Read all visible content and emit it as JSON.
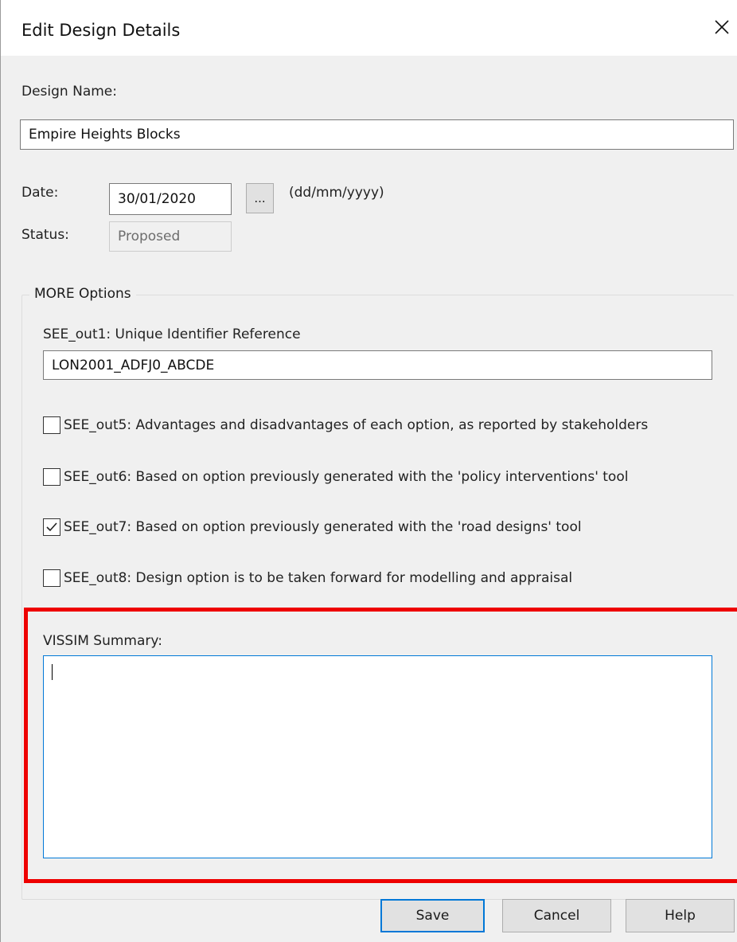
{
  "window": {
    "title": "Edit Design Details",
    "close_label": "✕"
  },
  "design_name": {
    "label": "Design Name:",
    "value": "Empire Heights  Blocks"
  },
  "date": {
    "label": "Date:",
    "value": "30/01/2020",
    "picker_label": "...",
    "format_hint": "(dd/mm/yyyy)"
  },
  "status": {
    "label": "Status:",
    "value": "Proposed"
  },
  "more_options": {
    "title": "MORE Options",
    "identifier_label": "SEE_out1: Unique Identifier Reference",
    "identifier_value": "LON2001_ADFJ0_ABCDE",
    "checkboxes": [
      {
        "label": "SEE_out5: Advantages and disadvantages of each option, as reported by stakeholders",
        "checked": false
      },
      {
        "label": "SEE_out6: Based on option previously generated with the 'policy interventions' tool",
        "checked": false
      },
      {
        "label": "SEE_out7: Based on option previously generated with the 'road designs' tool",
        "checked": true
      },
      {
        "label": "SEE_out8: Design option is to be taken forward for modelling and appraisal",
        "checked": false
      }
    ],
    "summary_label": "VISSIM Summary:",
    "summary_value": ""
  },
  "buttons": {
    "save": "Save",
    "cancel": "Cancel",
    "help": "Help"
  },
  "colors": {
    "highlight": "#ee0000",
    "focus_accent": "#0078d7"
  }
}
